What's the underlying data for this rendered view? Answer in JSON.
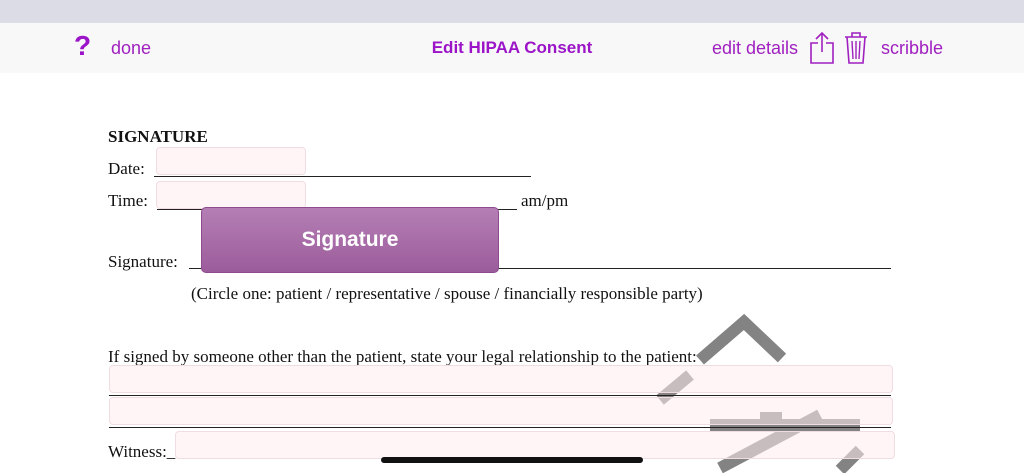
{
  "toolbar": {
    "help_glyph": "?",
    "done_label": "done",
    "title": "Edit HIPAA Consent",
    "edit_details_label": "edit details",
    "scribble_label": "scribble",
    "accent_color": "#9b14c8"
  },
  "form": {
    "heading": "SIGNATURE",
    "date_label": "Date:",
    "time_label": "Time:",
    "time_suffix": "am/pm",
    "signature_label": "Signature:",
    "signature_button": "Signature",
    "circle_note": "(Circle one: patient / representative / spouse / financially responsible party)",
    "relationship_prompt": "If signed by someone other than the patient, state your legal relationship to the patient:",
    "witness_label": "Witness:_",
    "date_value": "",
    "time_value": "",
    "relationship_line1_value": "",
    "relationship_line2_value": "",
    "witness_value": ""
  },
  "icons": {
    "help": "question-mark-icon",
    "share": "share-icon",
    "delete": "trash-icon"
  }
}
